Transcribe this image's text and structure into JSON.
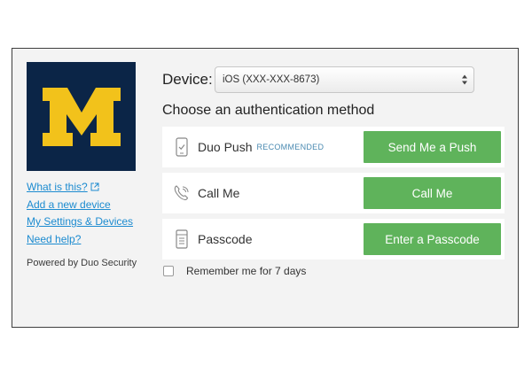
{
  "logo": {
    "letter": "M",
    "background": "#0b2547",
    "letter_color": "#f2c21b"
  },
  "sidebar": {
    "links": [
      {
        "label": "What is this?",
        "icon": "external-link-icon"
      },
      {
        "label": "Add a new device"
      },
      {
        "label": "My Settings & Devices"
      },
      {
        "label": "Need help?"
      }
    ],
    "powered_by": "Powered by Duo Security"
  },
  "device": {
    "label": "Device:",
    "selected": "iOS (XXX-XXX-8673)",
    "icon": "select-arrows-icon"
  },
  "heading": "Choose an authentication method",
  "methods": [
    {
      "label": "Duo Push",
      "badge": "RECOMMENDED",
      "button": "Send Me a Push",
      "icon": "phone-push-icon"
    },
    {
      "label": "Call Me",
      "badge": "",
      "button": "Call Me",
      "icon": "phone-call-icon"
    },
    {
      "label": "Passcode",
      "badge": "",
      "button": "Enter a Passcode",
      "icon": "passcode-icon"
    }
  ],
  "remember": {
    "label": "Remember me for 7 days",
    "checked": false
  },
  "colors": {
    "button": "#5fb35b",
    "link": "#1c8bd0",
    "panel": "#f3f3f3"
  }
}
